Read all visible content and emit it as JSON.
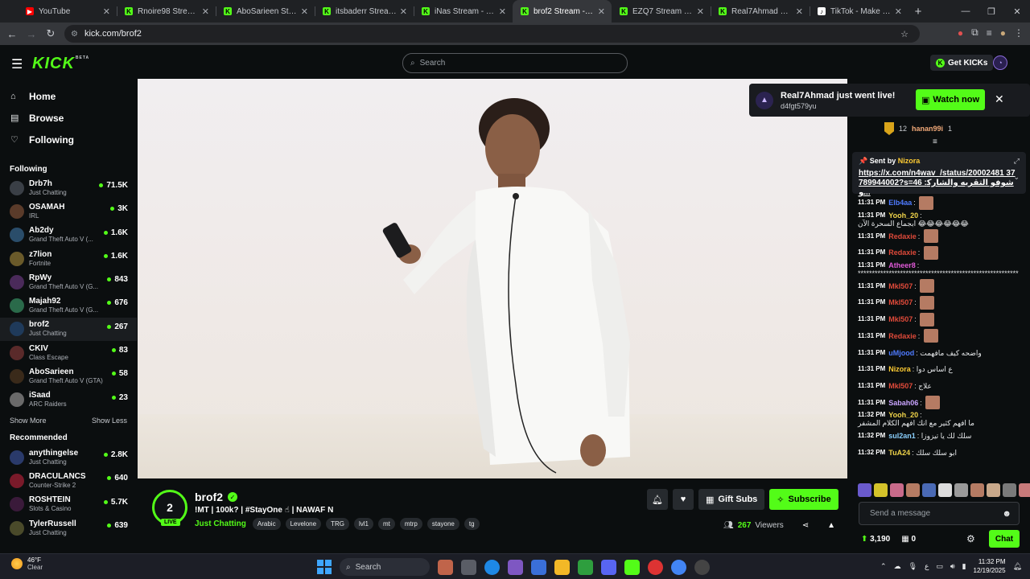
{
  "browser": {
    "tabs": [
      {
        "title": "YouTube",
        "icon": "youtube-icon",
        "color": "#ff0000"
      },
      {
        "title": "Rnoire98 Stream - W",
        "icon": "kick-icon",
        "color": "#53fc18"
      },
      {
        "title": "AboSarieen Stream -",
        "icon": "kick-icon",
        "color": "#53fc18"
      },
      {
        "title": "itsbaderr Stream - W",
        "icon": "kick-icon",
        "color": "#53fc18"
      },
      {
        "title": "iNas Stream - Watch",
        "icon": "kick-icon",
        "color": "#53fc18"
      },
      {
        "title": "brof2 Stream - Watc",
        "icon": "kick-icon",
        "color": "#53fc18",
        "active": true
      },
      {
        "title": "EZQ7 Stream - Watc",
        "icon": "kick-icon",
        "color": "#53fc18"
      },
      {
        "title": "Real7Ahmad Stream",
        "icon": "kick-icon",
        "color": "#53fc18"
      },
      {
        "title": "TikTok - Make Your D",
        "icon": "tiktok-icon",
        "color": "#ffffff"
      }
    ],
    "url": "kick.com/brof2"
  },
  "kick": {
    "logo": "KICK",
    "logo_beta": "BETA",
    "search_placeholder": "Search",
    "get_kicks": "Get KICKs",
    "accent": "#53fc18"
  },
  "sidebar": {
    "nav": [
      {
        "label": "Home",
        "icon": "home-icon"
      },
      {
        "label": "Browse",
        "icon": "browse-icon"
      },
      {
        "label": "Following",
        "icon": "heart-icon"
      }
    ],
    "following_title": "Following",
    "following": [
      {
        "name": "Drb7h",
        "game": "Just Chatting",
        "viewers": "71.5K"
      },
      {
        "name": "OSAMAH",
        "game": "IRL",
        "viewers": "3K"
      },
      {
        "name": "Ab2dy",
        "game": "Grand Theft Auto V (...",
        "viewers": "1.6K"
      },
      {
        "name": "z7lion",
        "game": "Fortnite",
        "viewers": "1.6K"
      },
      {
        "name": "RpWy",
        "game": "Grand Theft Auto V (G...",
        "viewers": "843"
      },
      {
        "name": "Majah92",
        "game": "Grand Theft Auto V (G...",
        "viewers": "676"
      },
      {
        "name": "brof2",
        "game": "Just Chatting",
        "viewers": "267"
      },
      {
        "name": "CKIV",
        "game": "Class Escape",
        "viewers": "83"
      },
      {
        "name": "AboSarieen",
        "game": "Grand Theft Auto V (GTA)",
        "viewers": "58"
      },
      {
        "name": "iSaad",
        "game": "ARC Raiders",
        "viewers": "23"
      }
    ],
    "show_more": "Show More",
    "show_less": "Show Less",
    "recommended_title": "Recommended",
    "recommended": [
      {
        "name": "anythingelse",
        "game": "Just Chatting",
        "viewers": "2.8K"
      },
      {
        "name": "DRACULANCS",
        "game": "Counter-Strike 2",
        "viewers": "640"
      },
      {
        "name": "ROSHTEIN",
        "game": "Slots & Casino",
        "viewers": "5.7K"
      },
      {
        "name": "TylerRussell",
        "game": "Just Chatting",
        "viewers": "639"
      }
    ]
  },
  "notification": {
    "title": "Real7Ahmad just went live!",
    "subtitle": "d4fgt579yu",
    "button": "Watch now"
  },
  "stream": {
    "name": "brof2",
    "avatar_text": "2",
    "live": "LIVE",
    "title": "!MT | 100k? | #StayOne ☝ | NAWAF N",
    "category": "Just Chatting",
    "tags": [
      "Arabic",
      "Levelone",
      "TRG",
      "lvl1",
      "mt",
      "mtrp",
      "stayone",
      "tg"
    ],
    "gift_subs": "Gift Subs",
    "subscribe": "Subscribe",
    "viewers": "267",
    "viewers_label": "Viewers"
  },
  "chat": {
    "gifter_count": "12",
    "gifter_name": "hanan99i",
    "gifter_num": "1",
    "pinned_by_label": "Sent by",
    "pinned_by": "Nizora",
    "pinned_link": "https://x.com/n4wav_/status/20002481 37789944002?s=46 :شوفو التقريه والشاركو...",
    "messages": [
      {
        "time": "11:31 PM",
        "user": "Elb4aa",
        "color": "#4f7bff",
        "text": ""
      },
      {
        "time": "11:31 PM",
        "user": "Yooh_20",
        "color": "#f0d44a",
        "text": "ابجماع السحرة الآن 😂😂😂😂😂😂"
      },
      {
        "time": "11:31 PM",
        "user": "Redaxie",
        "color": "#e04a3a",
        "text": ""
      },
      {
        "time": "11:31 PM",
        "user": "Redaxie",
        "color": "#e04a3a",
        "text": ""
      },
      {
        "time": "11:31 PM",
        "user": "Atheer8",
        "color": "#e05ad8",
        "text": "*********************************************************"
      },
      {
        "time": "11:31 PM",
        "user": "Mkl507",
        "color": "#e04a3a",
        "text": ""
      },
      {
        "time": "11:31 PM",
        "user": "Mkl507",
        "color": "#e04a3a",
        "text": ""
      },
      {
        "time": "11:31 PM",
        "user": "Mkl507",
        "color": "#e04a3a",
        "text": ""
      },
      {
        "time": "11:31 PM",
        "user": "Redaxie",
        "color": "#e04a3a",
        "text": ""
      },
      {
        "time": "11:31 PM",
        "user": "uMjood",
        "color": "#4f7bff",
        "text": "واضحه كيف مافهمت"
      },
      {
        "time": "11:31 PM",
        "user": "Nizora",
        "color": "#ffcc33",
        "text": "ع اساس دوا"
      },
      {
        "time": "11:31 PM",
        "user": "Mkl507",
        "color": "#e04a3a",
        "text": "علاج"
      },
      {
        "time": "11:31 PM",
        "user": "Sabah06",
        "color": "#c9a4ff",
        "text": ""
      },
      {
        "time": "11:32 PM",
        "user": "Yooh_20",
        "color": "#f0d44a",
        "text": "ما افهم كثير مع انك افهم الكلام المشفر"
      },
      {
        "time": "11:32 PM",
        "user": "sul2an1",
        "color": "#8ad0ff",
        "text": "سلك لك يا تيزوزا"
      },
      {
        "time": "11:32 PM",
        "user": "TuA24",
        "color": "#f0d44a",
        "text": "ابو سلك سلك"
      }
    ],
    "input_placeholder": "Send a message",
    "points": "3,190",
    "gifts": "0",
    "chat_button": "Chat"
  },
  "taskbar": {
    "temp": "46°F",
    "weather": "Clear",
    "search": "Search",
    "time": "11:32 PM",
    "date": "12/19/2025"
  }
}
